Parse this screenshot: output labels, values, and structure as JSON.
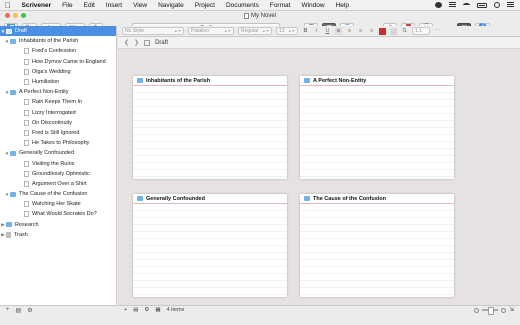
{
  "menubar": {
    "app": "Scrivener",
    "items": [
      "File",
      "Edit",
      "Insert",
      "View",
      "Navigate",
      "Project",
      "Documents",
      "Format",
      "Window",
      "Help"
    ]
  },
  "window": {
    "title": "My Novel"
  },
  "toolbar": {
    "document_title": "Draft"
  },
  "formatbar": {
    "style": "No Style",
    "font": "Palatino",
    "weight": "Regular",
    "size": "13",
    "bold": "B",
    "italic": "I",
    "underline": "U",
    "line_spacing": "1.1",
    "text_color": "#cc2d2d",
    "highlight_color": "#d6d6d6"
  },
  "binder": {
    "draft_label": "Draft",
    "chapters": [
      {
        "title": "Inhabitants of the Parish",
        "scenes": [
          "Fred's Confession",
          "How Dymov Came to England",
          "Olga's Wedding",
          "Humiliation"
        ]
      },
      {
        "title": "A Perfect Non-Entity",
        "scenes": [
          "Rain Keeps Them In",
          "Lizzy Interrogated",
          "On Discontinuity",
          "Fred is Still Ignored",
          "He Takes to Philosophy"
        ]
      },
      {
        "title": "Generally Confounded",
        "scenes": [
          "Visiting the Ruins",
          "Groundlessly Optimistic",
          "Argument Over a Shirt"
        ]
      },
      {
        "title": "The Cause of the Confusion",
        "scenes": [
          "Watching Her Skate",
          "What Would Socrates Do?"
        ]
      }
    ],
    "research_label": "Research",
    "trash_label": "Trash"
  },
  "header": {
    "title": "Draft"
  },
  "corkboard": {
    "cards": [
      {
        "title": "Inhabitants of the Parish"
      },
      {
        "title": "A Perfect Non-Entity"
      },
      {
        "title": "Generally Confounded"
      },
      {
        "title": "The Cause of the Confusion"
      }
    ],
    "item_count": "4 items"
  },
  "colors": {
    "selection": "#4b8fe5",
    "folder": "#6fb3ea",
    "card_rule": "#e8b7b7"
  }
}
